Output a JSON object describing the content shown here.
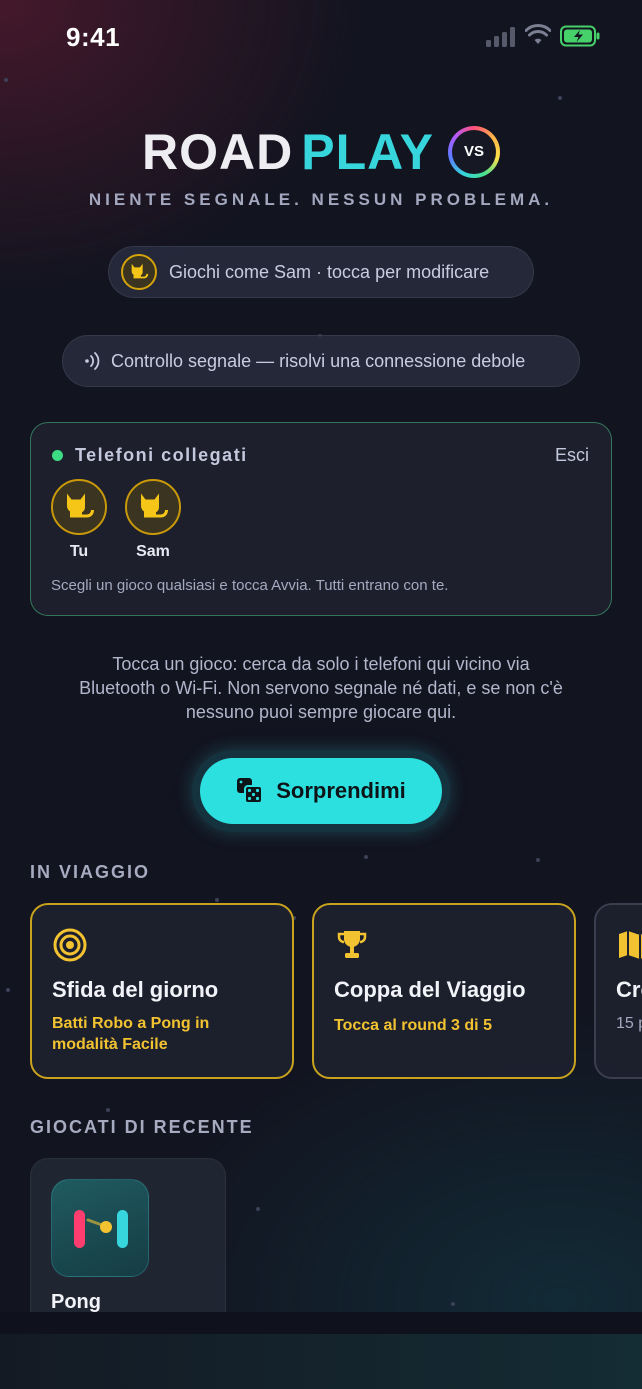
{
  "status_bar": {
    "time": "9:41"
  },
  "logo": {
    "road": "ROAD",
    "play": "PLAY",
    "badge": "VS"
  },
  "tagline": "NIENTE SEGNALE. NESSUN PROBLEMA.",
  "profile": {
    "label": "Giochi come Sam · tocca per modificare",
    "icon": "cat-icon"
  },
  "signal_check": {
    "label": "Controllo segnale — risolvi una connessione debole",
    "icon": "signal-waves-icon"
  },
  "connected": {
    "title": "Telefoni collegati",
    "exit_label": "Esci",
    "players": [
      {
        "name": "Tu",
        "icon": "cat-icon"
      },
      {
        "name": "Sam",
        "icon": "cat-icon"
      }
    ],
    "hint": "Scegli un gioco qualsiasi e tocca Avvia. Tutti entrano con te."
  },
  "explain_lines": [
    "Tocca un gioco: cerca da solo i telefoni qui vicino via",
    "Bluetooth o Wi-Fi. Non servono segnale né dati, e se non c'è",
    "nessuno puoi sempre giocare qui."
  ],
  "surprise_button": {
    "label": "Sorprendimi",
    "icon": "dice-icon"
  },
  "travel": {
    "section_title": "IN VIAGGIO",
    "cards": [
      {
        "title": "Sfida del giorno",
        "subtitle_lines": [
          "Batti Robo a Pong in",
          "modalità Facile"
        ],
        "icon": "target-icon"
      },
      {
        "title": "Coppa del Viaggio",
        "subtitle_lines": [
          "Tocca al round 3 di 5"
        ],
        "icon": "trophy-icon"
      },
      {
        "title": "Cro",
        "subtitle_lines": [
          "15 p"
        ],
        "icon": "map-icon"
      }
    ]
  },
  "recent": {
    "section_title": "GIOCATI DI RECENTE",
    "games": [
      {
        "name": "Pong",
        "icon": "pong-icon"
      }
    ]
  },
  "colors": {
    "accent": "#2de0e0",
    "gold": "#f2c230",
    "green": "#3ddc84"
  }
}
